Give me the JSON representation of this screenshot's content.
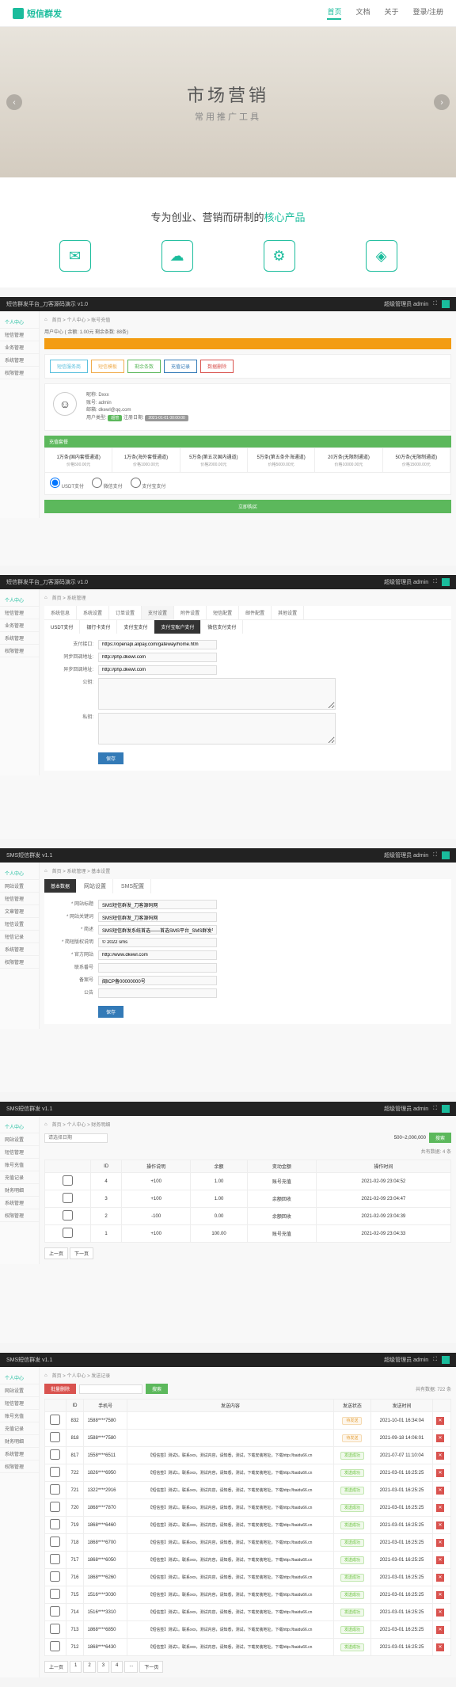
{
  "landing": {
    "logo": "短信群发",
    "nav": [
      "首页",
      "文档",
      "关于",
      "登录/注册"
    ],
    "hero_title": "市场营销",
    "hero_sub": "常用推广工具",
    "subtitle_pre": "专为创业、营销而研制的",
    "subtitle_accent": "核心产品"
  },
  "panel1": {
    "title": "短信群发平台_刀客源码演示  v1.0",
    "user_label": "超级管理员  admin",
    "sidebar": [
      "个人中心",
      "短信管理",
      "业务管理",
      "系统管理",
      "权限管理"
    ],
    "breadcrumb": "首页 > 个人中心 > 账号充值",
    "balance_bar": "用户中心 ( 余额: 1.00元 剩余条数: 88条)",
    "tabs": [
      "短信服务商",
      "短信模板",
      "剩余条数",
      "充值记录",
      "数据删除"
    ],
    "user": {
      "name": "昵称: Dxxx",
      "account": "账号: admin",
      "email": "邮箱: dkewl@qq.com",
      "type_label": "用户类型:",
      "type_badge": "超管",
      "reg_label": "注册日期:",
      "reg_date": "2021-01-01 00:00:00"
    },
    "pkg_header": "充值套餐",
    "packages": [
      {
        "t": "1万条(国内套餐通道)",
        "p": "价格500.00元"
      },
      {
        "t": "1万条(海外套餐通道)",
        "p": "价格1000.00元"
      },
      {
        "t": "5万条(第五次国内通道)",
        "p": "价格2000.00元"
      },
      {
        "t": "5万条(第五条外海通道)",
        "p": "价格5000.00元"
      },
      {
        "t": "20万条(无限制通道)",
        "p": "价格10000.00元"
      },
      {
        "t": "50万条(无限制通道)",
        "p": "价格15000.00元"
      }
    ],
    "pay_options": [
      "USDT支付",
      "微信支付",
      "支付宝支付"
    ],
    "submit": "立即购买"
  },
  "panel2": {
    "title": "短信群发平台_刀客源码演示  v1.0",
    "sidebar": [
      "个人中心",
      "短信管理",
      "业务管理",
      "系统管理",
      "权限管理"
    ],
    "breadcrumb": "首页 > 系统管理",
    "tabs": [
      "系统信息",
      "系统设置",
      "订单设置",
      "支付设置",
      "附件设置",
      "短信配置",
      "邮件配置",
      "其他设置"
    ],
    "subtabs": [
      "USDT支付",
      "银行卡支付",
      "支付宝支付",
      "支付宝账户支付",
      "微信支付支付"
    ],
    "fields": {
      "alipay_gateway_label": "支付接口:",
      "alipay_gateway": "https://openapi.alipay.com/gateway/home.htm",
      "sync_label": "同步回调地址:",
      "sync_url": "http://php.dkewl.com",
      "async_label": "异步回调地址:",
      "async_url": "http://php.dkewl.com",
      "pubkey_label": "公钥:",
      "privkey_label": "私钥:"
    },
    "save": "保存"
  },
  "panel3": {
    "title": "SMS短信群发  v1.1",
    "sidebar": [
      "个人中心",
      "网站设置",
      "短信管理",
      "文章管理",
      "短信设置",
      "短信记录",
      "系统管理",
      "权限管理"
    ],
    "breadcrumb": "首页 > 系统管理 > 基本设置",
    "tabs": [
      "基本数据",
      "网站设置",
      "SMS配置"
    ],
    "fields": [
      {
        "l": "* 网站标题",
        "v": "SMS短信群发_刀客源码网"
      },
      {
        "l": "* 网站关键词",
        "v": "SMS短信群发_刀客源码网"
      },
      {
        "l": "* 简述",
        "v": "SMS短信群发系统首选——首选SMS平台_SMS群发平台"
      },
      {
        "l": "* 简短版权说明",
        "v": "© 2022 sms"
      },
      {
        "l": "* 官方网站",
        "v": "http://www.dkewl.com"
      },
      {
        "l": "联系番号",
        "v": ""
      },
      {
        "l": "备案号",
        "v": "闽ICP备00000000号"
      },
      {
        "l": "公告",
        "v": ""
      }
    ],
    "save": "保存"
  },
  "panel4": {
    "title": "SMS短信群发  v1.1",
    "sidebar": [
      "个人中心",
      "网站设置",
      "短信管理",
      "账号充值",
      "充值记录",
      "财务明细",
      "系统管理",
      "权限管理"
    ],
    "breadcrumb": "首页 > 个人中心 > 财务明细",
    "filter_placeholder": "请选择日期",
    "amount_range": "500~2,000,000",
    "search": "搜索",
    "total": "共有数据: 4 条",
    "headers": [
      "",
      "ID",
      "操作说明",
      "余额",
      "变动金额",
      "操作时间"
    ],
    "rows": [
      [
        "",
        "4",
        "+100",
        "1.00",
        "账号充值",
        "2021-02-09 23:04:52"
      ],
      [
        "",
        "3",
        "+100",
        "1.00",
        "余额回收",
        "2021-02-09 23:04:47"
      ],
      [
        "",
        "2",
        "-100",
        "0.00",
        "余额回收",
        "2021-02-09 23:04:39"
      ],
      [
        "",
        "1",
        "+100",
        "100.00",
        "账号充值",
        "2021-02-09 23:04:33"
      ]
    ],
    "pagination": [
      "上一页",
      "下一页"
    ]
  },
  "panel5": {
    "title": "SMS短信群发  v1.1",
    "sidebar": [
      "个人中心",
      "网站设置",
      "短信管理",
      "账号充值",
      "充值记录",
      "财务明细",
      "系统管理",
      "权限管理"
    ],
    "breadcrumb": "首页 > 个人中心 > 发送记录",
    "delete_btn": "批量删除",
    "total": "共有数据: 722 条",
    "headers": [
      "",
      "ID",
      "手机号",
      "发送内容",
      "发送状态",
      "发送时间",
      ""
    ],
    "rows": [
      {
        "id": "832",
        "phone": "1588****7580",
        "content": "",
        "status": "待发送",
        "time": "2021-10-01 16:34:04"
      },
      {
        "id": "818",
        "phone": "1588****7580",
        "content": "",
        "status": "待发送",
        "time": "2021-09-18 14:06:01"
      },
      {
        "id": "817",
        "phone": "1558****6511",
        "content": "【短信签】测试5。联系xxx，测试内容，请知悉，测试，下载安装地址，下载http://baidu66.cn",
        "status": "发送成功",
        "time": "2021-07-07 11:10:04"
      },
      {
        "id": "722",
        "phone": "1826****6950",
        "content": "【短信签】测试1。联系xxx，测试内容，请知悉，测试，下载安装地址，下载http://baidu66.cn",
        "status": "发送成功",
        "time": "2021-03-01 16:25:25"
      },
      {
        "id": "721",
        "phone": "1322****2916",
        "content": "【短信签】测试1。联系xxx，测试内容，请知悉，测试，下载安装地址，下载http://baidu66.cn",
        "status": "发送成功",
        "time": "2021-03-01 16:25:25"
      },
      {
        "id": "720",
        "phone": "1868****7870",
        "content": "【短信签】测试1。联系xxx，测试内容，请知悉，测试，下载安装地址，下载http://baidu66.cn",
        "status": "发送成功",
        "time": "2021-03-01 16:25:25"
      },
      {
        "id": "719",
        "phone": "1868****6460",
        "content": "【短信签】测试1。联系xxx，测试内容，请知悉，测试，下载安装地址，下载http://baidu66.cn",
        "status": "发送成功",
        "time": "2021-03-01 16:25:25"
      },
      {
        "id": "718",
        "phone": "1868****6700",
        "content": "【短信签】测试1。联系xxx，测试内容，请知悉，测试，下载安装地址，下载http://baidu66.cn",
        "status": "发送成功",
        "time": "2021-03-01 16:25:25"
      },
      {
        "id": "717",
        "phone": "1868****6050",
        "content": "【短信签】测试1。联系xxx，测试内容，请知悉，测试，下载安装地址，下载http://baidu66.cn",
        "status": "发送成功",
        "time": "2021-03-01 16:25:25"
      },
      {
        "id": "716",
        "phone": "1868****6260",
        "content": "【短信签】测试1。联系xxx，测试内容，请知悉，测试，下载安装地址，下载http://baidu66.cn",
        "status": "发送成功",
        "time": "2021-03-01 16:25:25"
      },
      {
        "id": "715",
        "phone": "1516****3030",
        "content": "【短信签】测试1。联系xxx，测试内容，请知悉，测试，下载安装地址，下载http://baidu66.cn",
        "status": "发送成功",
        "time": "2021-03-01 16:25:25"
      },
      {
        "id": "714",
        "phone": "1516****3310",
        "content": "【短信签】测试1。联系xxx，测试内容，请知悉，测试，下载安装地址，下载http://baidu66.cn",
        "status": "发送成功",
        "time": "2021-03-01 16:25:25"
      },
      {
        "id": "713",
        "phone": "1868****6850",
        "content": "【短信签】测试1。联系xxx，测试内容，请知悉，测试，下载安装地址，下载http://baidu66.cn",
        "status": "发送成功",
        "time": "2021-03-01 16:25:25"
      },
      {
        "id": "712",
        "phone": "1868****6430",
        "content": "【短信签】测试1。联系xxx，测试内容，请知悉，测试，下载安装地址，下载http://baidu66.cn",
        "status": "发送成功",
        "time": "2021-03-01 16:25:25"
      }
    ],
    "pagination": [
      "上一页",
      "1",
      "2",
      "3",
      "4",
      "...",
      "下一页"
    ]
  }
}
